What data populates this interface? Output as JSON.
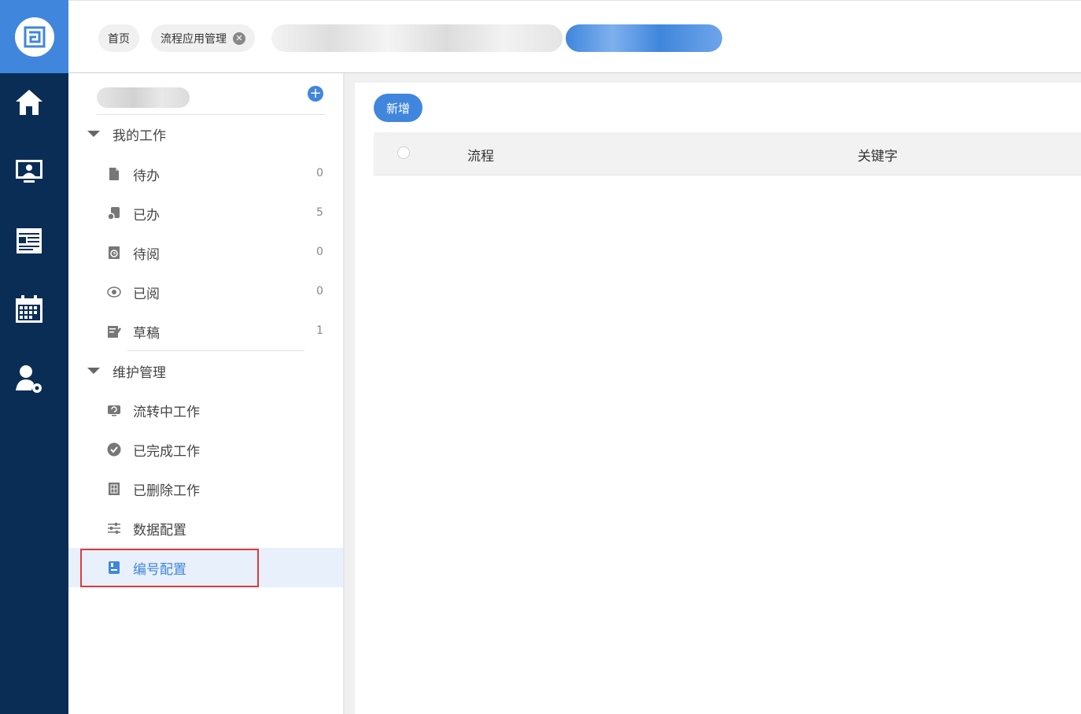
{
  "topbar": {
    "tabs": [
      {
        "label": "首页"
      },
      {
        "label": "流程应用管理",
        "closable": true
      }
    ]
  },
  "rail": {
    "icons": [
      "logo-icon",
      "home-icon",
      "monitor-user-icon",
      "news-icon",
      "calendar-icon",
      "user-settings-icon"
    ]
  },
  "sidebar": {
    "groups": [
      {
        "label": "我的工作",
        "items": [
          {
            "label": "待办",
            "count": "0",
            "icon": "document-icon"
          },
          {
            "label": "已办",
            "count": "5",
            "icon": "done-document-icon"
          },
          {
            "label": "待阅",
            "count": "0",
            "icon": "clock-document-icon"
          },
          {
            "label": "已阅",
            "count": "0",
            "icon": "eye-icon"
          },
          {
            "label": "草稿",
            "count": "1",
            "icon": "draft-icon"
          }
        ]
      },
      {
        "label": "维护管理",
        "items": [
          {
            "label": "流转中工作",
            "icon": "flow-icon"
          },
          {
            "label": "已完成工作",
            "icon": "check-circle-icon"
          },
          {
            "label": "已删除工作",
            "icon": "deleted-icon"
          },
          {
            "label": "数据配置",
            "icon": "sliders-icon"
          },
          {
            "label": "编号配置",
            "icon": "number-config-icon",
            "active": true
          }
        ]
      }
    ]
  },
  "main": {
    "add_button": "新增",
    "table": {
      "columns": [
        "流程",
        "关键字"
      ],
      "rows": []
    }
  },
  "colors": {
    "rail": "#0a2d55",
    "accent": "#3f86dc",
    "highlight_box": "#e0393e"
  }
}
